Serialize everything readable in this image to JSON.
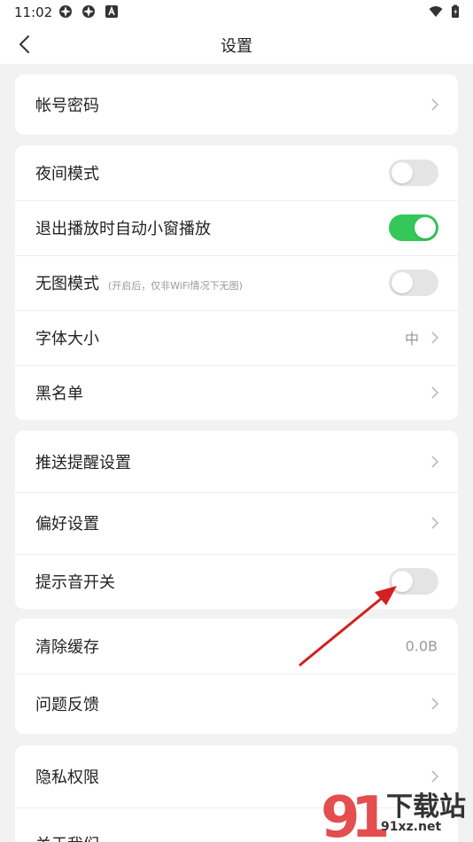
{
  "status_bar": {
    "time": "11:02"
  },
  "nav": {
    "title": "设置"
  },
  "colors": {
    "toggle_on": "#34c759",
    "toggle_off": "#e4e4e4",
    "arrow": "#d32020"
  },
  "sections": [
    {
      "rows": [
        {
          "label": "帐号密码"
        }
      ]
    },
    {
      "rows": [
        {
          "label": "夜间模式",
          "toggle": false
        },
        {
          "label": "退出播放时自动小窗播放",
          "toggle": true
        },
        {
          "label": "无图模式",
          "sub": "(开启后，仅非WiFi情况下无图)",
          "toggle": false
        },
        {
          "label": "字体大小",
          "value": "中"
        },
        {
          "label": "黑名单"
        }
      ]
    },
    {
      "rows": [
        {
          "label": "推送提醒设置"
        },
        {
          "label": "偏好设置"
        },
        {
          "label": "提示音开关",
          "toggle": false
        }
      ]
    },
    {
      "rows": [
        {
          "label": "清除缓存",
          "value": "0.0B"
        },
        {
          "label": "问题反馈"
        }
      ]
    },
    {
      "rows": [
        {
          "label": "隐私权限"
        },
        {
          "label": "关于我们"
        }
      ]
    }
  ],
  "watermark": {
    "brand": "下载站",
    "site": "91xz.net"
  }
}
